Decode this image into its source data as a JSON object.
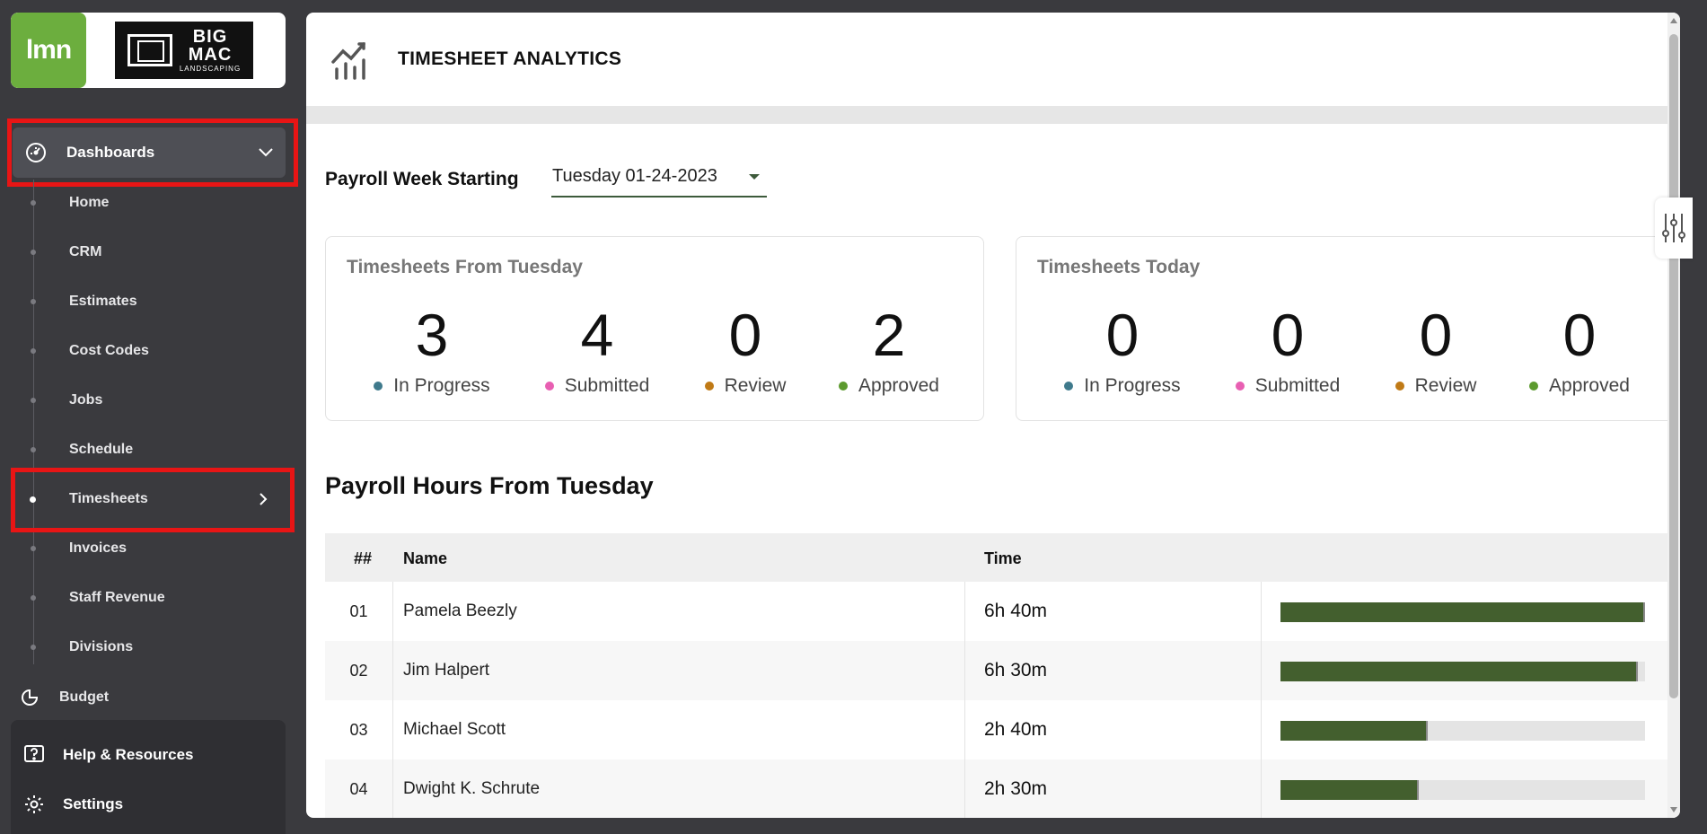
{
  "sidebar": {
    "logo_lmn": "lmn",
    "logo_company": {
      "line1": "BIG",
      "line2": "MAC",
      "line3": "LANDSCAPING"
    },
    "dashboards_label": "Dashboards",
    "items": [
      {
        "label": "Home"
      },
      {
        "label": "CRM"
      },
      {
        "label": "Estimates"
      },
      {
        "label": "Cost Codes"
      },
      {
        "label": "Jobs"
      },
      {
        "label": "Schedule"
      },
      {
        "label": "Timesheets",
        "active": true
      },
      {
        "label": "Invoices"
      },
      {
        "label": "Staff Revenue"
      },
      {
        "label": "Divisions"
      }
    ],
    "budget_label": "Budget",
    "help_label": "Help & Resources",
    "settings_label": "Settings"
  },
  "header": {
    "title": "TIMESHEET ANALYTICS"
  },
  "payroll_week": {
    "label": "Payroll Week Starting",
    "value": "Tuesday 01-24-2023"
  },
  "cards": [
    {
      "title": "Timesheets From Tuesday",
      "stats": [
        {
          "value": "3",
          "label": "In Progress",
          "color": "#3f7a8c"
        },
        {
          "value": "4",
          "label": "Submitted",
          "color": "#e85fb2"
        },
        {
          "value": "0",
          "label": "Review",
          "color": "#c07a16"
        },
        {
          "value": "2",
          "label": "Approved",
          "color": "#5c9a2e"
        }
      ]
    },
    {
      "title": "Timesheets Today",
      "stats": [
        {
          "value": "0",
          "label": "In Progress",
          "color": "#3f7a8c"
        },
        {
          "value": "0",
          "label": "Submitted",
          "color": "#e85fb2"
        },
        {
          "value": "0",
          "label": "Review",
          "color": "#c07a16"
        },
        {
          "value": "0",
          "label": "Approved",
          "color": "#5c9a2e"
        }
      ]
    }
  ],
  "hours": {
    "title": "Payroll Hours From Tuesday",
    "columns": {
      "num": "##",
      "name": "Name",
      "time": "Time"
    },
    "rows": [
      {
        "num": "01",
        "name": "Pamela Beezly",
        "time": "6h 40m",
        "fraction": 1.0
      },
      {
        "num": "02",
        "name": "Jim Halpert",
        "time": "6h 30m",
        "fraction": 0.98
      },
      {
        "num": "03",
        "name": "Michael Scott",
        "time": "2h 40m",
        "fraction": 0.405
      },
      {
        "num": "04",
        "name": "Dwight K. Schrute",
        "time": "2h 30m",
        "fraction": 0.38
      }
    ]
  },
  "colors": {
    "accent": "#435f2e",
    "highlight": "#e81515",
    "sidebar": "#3a3a3e"
  }
}
